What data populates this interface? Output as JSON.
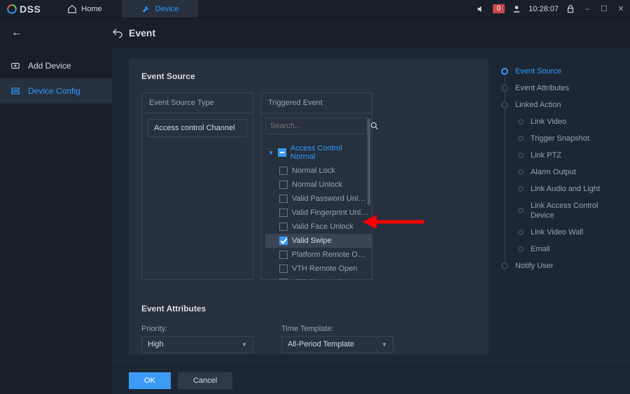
{
  "app": {
    "name": "DSS"
  },
  "titlebar": {
    "tabs": [
      {
        "id": "home",
        "label": "Home"
      },
      {
        "id": "device",
        "label": "Device"
      }
    ],
    "alarm_count": "0",
    "time": "10:28:07"
  },
  "page": {
    "back_icon": "←",
    "title": "Event"
  },
  "sidebar": {
    "items": [
      {
        "id": "add-device",
        "label": "Add Device"
      },
      {
        "id": "device-config",
        "label": "Device Config"
      }
    ]
  },
  "event_source": {
    "heading": "Event Source",
    "type_header": "Event Source Type",
    "selected_type": "Access control Channel",
    "trigger_header": "Triggered Event",
    "search_placeholder": "Search...",
    "group_label": "Access Control Normal",
    "events": [
      {
        "label": "Normal Lock",
        "checked": false
      },
      {
        "label": "Normal Unlock",
        "checked": false
      },
      {
        "label": "Valid Password Unlock",
        "checked": false
      },
      {
        "label": "Valid Fingerprint Unlock",
        "checked": false
      },
      {
        "label": "Valid Face Unlock",
        "checked": false
      },
      {
        "label": "Valid Swipe",
        "checked": true
      },
      {
        "label": "Platform Remote Open",
        "checked": false
      },
      {
        "label": "VTH Remote Open",
        "checked": false
      },
      {
        "label": "VTS Remote Open",
        "checked": false
      }
    ]
  },
  "event_attrs": {
    "heading": "Event Attributes",
    "priority_label": "Priority:",
    "priority_value": "High",
    "template_label": "Time Template:",
    "template_value": "All-Period Template"
  },
  "anchors": [
    {
      "label": "Event Source",
      "level": 0,
      "active": true
    },
    {
      "label": "Event Attributes",
      "level": 0,
      "active": false
    },
    {
      "label": "Linked Action",
      "level": 0,
      "active": false
    },
    {
      "label": "Link Video",
      "level": 1,
      "active": false
    },
    {
      "label": "Trigger Snapshot",
      "level": 1,
      "active": false
    },
    {
      "label": "Link PTZ",
      "level": 1,
      "active": false
    },
    {
      "label": "Alarm Output",
      "level": 1,
      "active": false
    },
    {
      "label": "Link Audio and Light",
      "level": 1,
      "active": false
    },
    {
      "label": "Link Access Control Device",
      "level": 1,
      "active": false
    },
    {
      "label": "Link Video Wall",
      "level": 1,
      "active": false
    },
    {
      "label": "Email",
      "level": 1,
      "active": false
    },
    {
      "label": "Notify User",
      "level": 0,
      "active": false
    }
  ],
  "footer": {
    "ok": "OK",
    "cancel": "Cancel"
  }
}
